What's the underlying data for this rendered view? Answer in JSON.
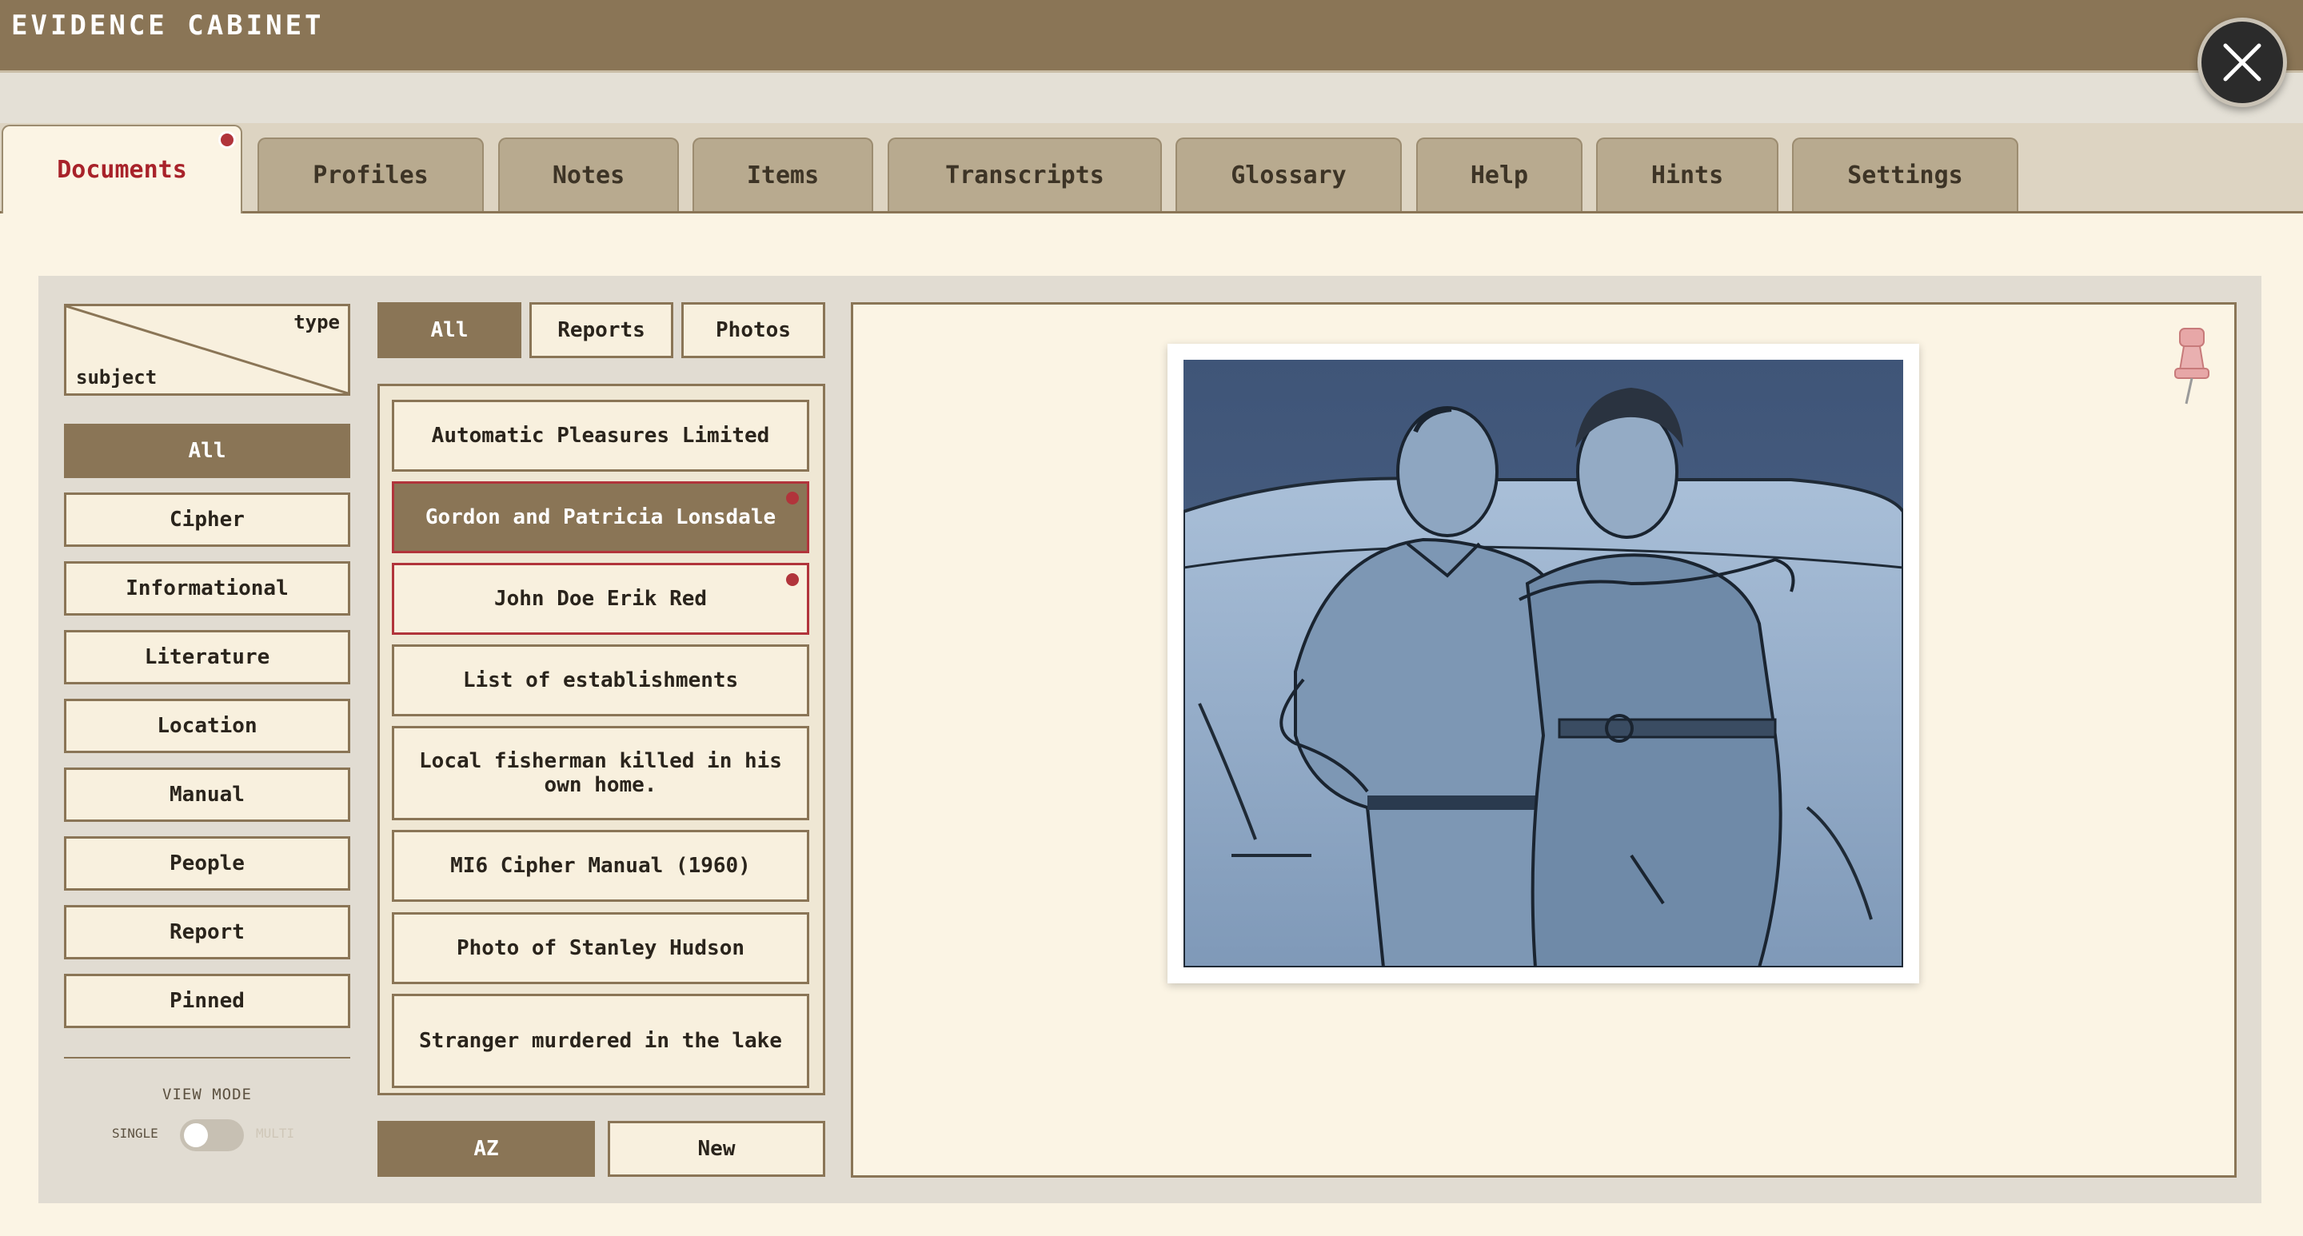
{
  "app": {
    "title": "EVIDENCE CABINET"
  },
  "tabs": [
    {
      "label": "Documents",
      "active": true,
      "has_new": true
    },
    {
      "label": "Profiles"
    },
    {
      "label": "Notes"
    },
    {
      "label": "Items"
    },
    {
      "label": "Transcripts"
    },
    {
      "label": "Glossary"
    },
    {
      "label": "Help"
    },
    {
      "label": "Hints"
    },
    {
      "label": "Settings"
    }
  ],
  "sort_header": {
    "type_label": "type",
    "subject_label": "subject"
  },
  "subjects": {
    "selected": "All",
    "items": [
      "All",
      "Cipher",
      "Informational",
      "Literature",
      "Location",
      "Manual",
      "People",
      "Report",
      "Pinned"
    ]
  },
  "type_filters": {
    "selected": "All",
    "items": [
      "All",
      "Reports",
      "Photos"
    ]
  },
  "documents": [
    {
      "title": "Automatic Pleasures Limited"
    },
    {
      "title": "Gordon and Patricia Lonsdale",
      "selected": true,
      "unread": true
    },
    {
      "title": "John Doe Erik Red",
      "unread": true
    },
    {
      "title": "List of establishments"
    },
    {
      "title": "Local fisherman killed in his own home."
    },
    {
      "title": "MI6 Cipher Manual (1960)"
    },
    {
      "title": "Photo of Stanley Hudson"
    },
    {
      "title": "Stranger murdered in the lake"
    }
  ],
  "sort": {
    "selected": "AZ",
    "options": [
      "AZ",
      "New"
    ]
  },
  "view_mode": {
    "label": "VIEW MODE",
    "single_label": "SINGLE",
    "multi_label": "MULTI",
    "value": "single"
  },
  "viewer": {
    "image": "illustrated-photo-of-couple-by-car",
    "pin_icon": "pushpin-icon"
  },
  "colors": {
    "header": "#8a7556",
    "accent_red": "#a8222a",
    "paper": "#fbf4e4",
    "selected_fill": "#8a7556"
  }
}
